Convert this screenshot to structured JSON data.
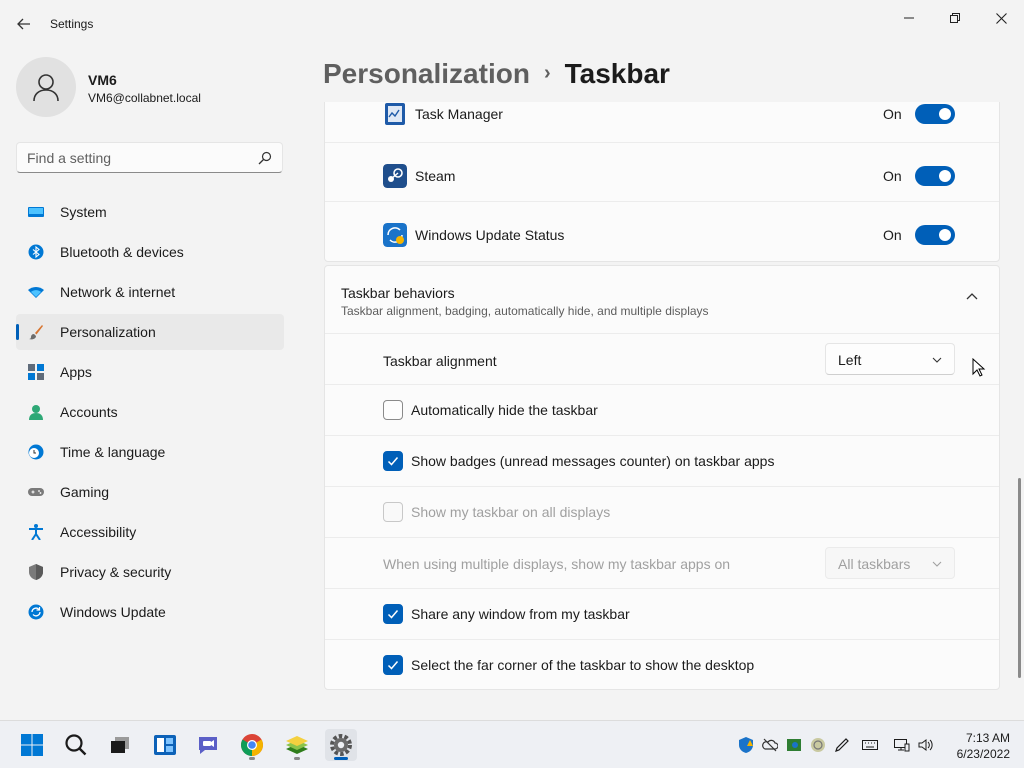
{
  "window": {
    "title": "Settings",
    "back_icon": "back-arrow-icon",
    "controls": [
      "minimize-icon",
      "maximize-icon",
      "close-icon"
    ]
  },
  "user": {
    "name": "VM6",
    "email": "VM6@collabnet.local"
  },
  "search": {
    "placeholder": "Find a setting"
  },
  "sidebar": {
    "items": [
      {
        "label": "System",
        "icon": "monitor-icon"
      },
      {
        "label": "Bluetooth & devices",
        "icon": "bluetooth-icon"
      },
      {
        "label": "Network & internet",
        "icon": "wifi-icon"
      },
      {
        "label": "Personalization",
        "icon": "paintbrush-icon",
        "active": true
      },
      {
        "label": "Apps",
        "icon": "apps-icon"
      },
      {
        "label": "Accounts",
        "icon": "person-icon"
      },
      {
        "label": "Time & language",
        "icon": "clock-globe-icon"
      },
      {
        "label": "Gaming",
        "icon": "gamepad-icon"
      },
      {
        "label": "Accessibility",
        "icon": "accessibility-icon"
      },
      {
        "label": "Privacy & security",
        "icon": "shield-icon"
      },
      {
        "label": "Windows Update",
        "icon": "update-icon"
      }
    ]
  },
  "breadcrumb": {
    "parent": "Personalization",
    "separator": "›",
    "current": "Taskbar"
  },
  "overflow_apps": [
    {
      "label": "Task Manager",
      "state": "On",
      "on": true,
      "icon": "task-manager-icon"
    },
    {
      "label": "Steam",
      "state": "On",
      "on": true,
      "icon": "steam-icon"
    },
    {
      "label": "Windows Update Status",
      "state": "On",
      "on": true,
      "icon": "windows-update-status-icon"
    }
  ],
  "behaviors": {
    "title": "Taskbar behaviors",
    "subtitle": "Taskbar alignment, badging, automatically hide, and multiple displays",
    "alignment": {
      "label": "Taskbar alignment",
      "value": "Left"
    },
    "auto_hide": {
      "label": "Automatically hide the taskbar",
      "checked": false
    },
    "badges": {
      "label": "Show badges (unread messages counter) on taskbar apps",
      "checked": true
    },
    "all_displays": {
      "label": "Show my taskbar on all displays",
      "checked": false,
      "disabled": true
    },
    "multi_display": {
      "label": "When using multiple displays, show my taskbar apps on",
      "value": "All taskbars",
      "disabled": true
    },
    "share_window": {
      "label": "Share any window from my taskbar",
      "checked": true
    },
    "far_corner": {
      "label": "Select the far corner of the taskbar to show the desktop",
      "checked": true
    }
  },
  "taskbar": {
    "apps": [
      "windows-start-icon",
      "search-icon",
      "task-view-icon",
      "widgets-icon",
      "teams-chat-icon",
      "chrome-icon",
      "bluestacks-icon",
      "settings-gear-icon"
    ],
    "tray": [
      "defender-icon",
      "onedrive-icon",
      "steam-tray-icon",
      "update-tray-icon",
      "pen-icon",
      "keyboard-icon",
      "network-icon",
      "volume-icon"
    ],
    "time": "7:13 AM",
    "date": "6/23/2022"
  },
  "colors": {
    "accent": "#005fb8",
    "background": "#f3f3f3",
    "card": "#fbfbfb"
  }
}
